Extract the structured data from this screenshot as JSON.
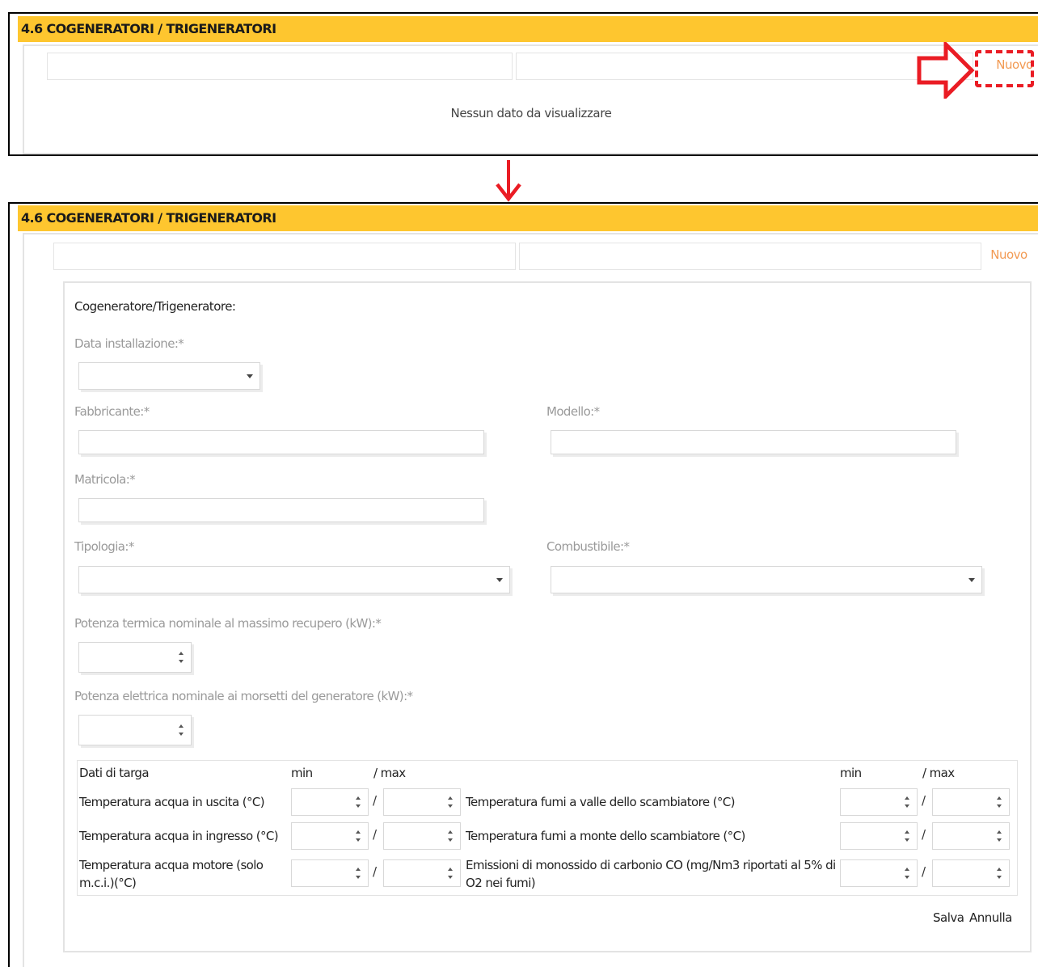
{
  "section": {
    "title": "4.6 COGENERATORI / TRIGENERATORI"
  },
  "top_panel": {
    "new_label": "Nuovo",
    "empty_message": "Nessun dato da visualizzare"
  },
  "annotations": {
    "highlight_color": "#ea1c24",
    "header_color": "#fec62f",
    "link_color": "#f29a53"
  },
  "bottom_panel": {
    "new_label": "Nuovo"
  },
  "form": {
    "title": "Cogeneratore/Trigeneratore:",
    "fields": {
      "data_installazione": {
        "label": "Data installazione:*",
        "value": ""
      },
      "fabbricante": {
        "label": "Fabbricante:*",
        "value": ""
      },
      "modello": {
        "label": "Modello:*",
        "value": ""
      },
      "matricola": {
        "label": "Matricola:*",
        "value": ""
      },
      "tipologia": {
        "label": "Tipologia:*",
        "value": ""
      },
      "combustibile": {
        "label": "Combustibile:*",
        "value": ""
      },
      "potenza_termica": {
        "label": "Potenza termica nominale al massimo recupero (kW):*",
        "value": ""
      },
      "potenza_elettrica": {
        "label": "Potenza elettrica nominale ai morsetti del generatore (kW):*",
        "value": ""
      }
    },
    "targa": {
      "title": "Dati di targa",
      "min_label": "min",
      "max_label": "/ max",
      "separator": "/",
      "left_rows": [
        {
          "label": "Temperatura acqua in uscita (°C)"
        },
        {
          "label": "Temperatura acqua in ingresso (°C)"
        },
        {
          "label": "Temperatura acqua motore (solo m.c.i.)(°C)"
        }
      ],
      "right_rows": [
        {
          "label": "Temperatura fumi a valle dello scambiatore (°C)"
        },
        {
          "label": "Temperatura fumi a monte dello scambiatore (°C)"
        },
        {
          "label": "Emissioni di monossido di carbonio CO (mg/Nm3 riportati al 5% di O2 nei fumi)"
        }
      ]
    },
    "actions": {
      "save": "Salva",
      "cancel": "Annulla"
    }
  }
}
